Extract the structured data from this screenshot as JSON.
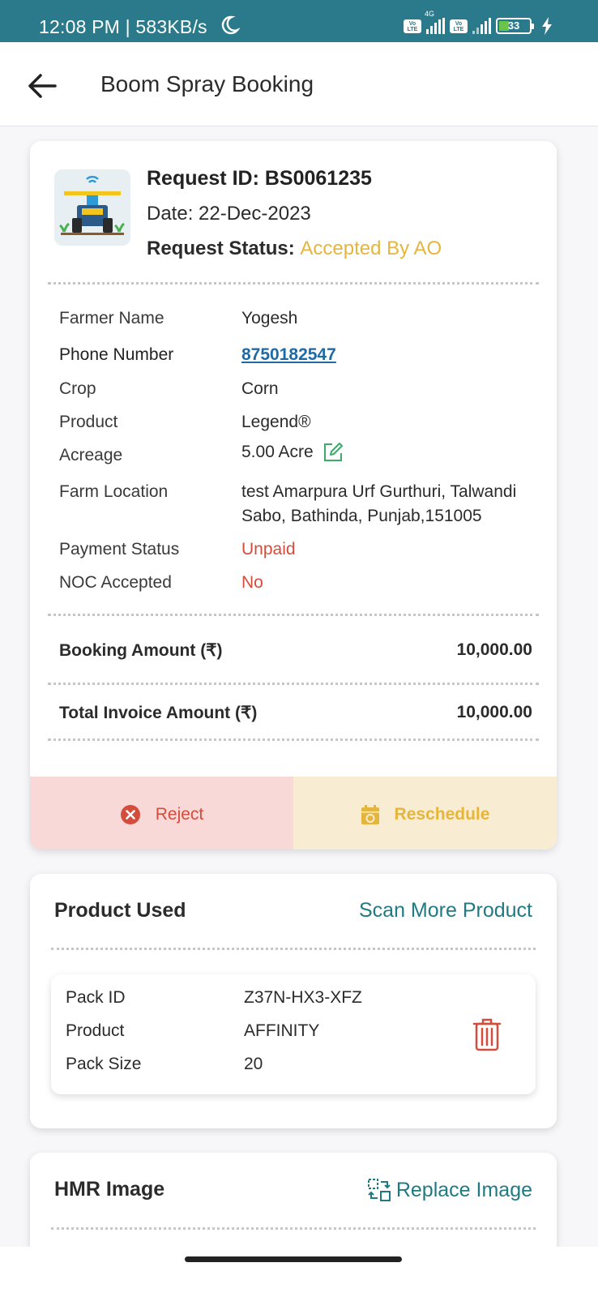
{
  "status_bar": {
    "time": "12:08 PM | 583KB/s",
    "network_type": "4G",
    "volte_label": "Vo LTE",
    "battery_level": "33",
    "icons": [
      "moon-icon",
      "signal-icon",
      "battery-icon",
      "charging-icon"
    ]
  },
  "app_bar": {
    "title": "Boom Spray Booking",
    "back_icon": "arrow-left-icon"
  },
  "request": {
    "id_label": "Request ID: BS0061235",
    "date_label": "Date: 22-Dec-2023",
    "status_label": "Request Status:",
    "status_value": "Accepted By AO",
    "status_color": "#e6b53b"
  },
  "details": [
    {
      "label": "Farmer Name",
      "value": "Yogesh"
    },
    {
      "label": "Phone Number",
      "value": "8750182547"
    },
    {
      "label": "Crop",
      "value": "Corn"
    },
    {
      "label": "Product",
      "value": "Legend®"
    },
    {
      "label": "Acreage",
      "value": "5.00 Acre"
    },
    {
      "label": "Farm Location",
      "value_line1": "test Amarpura Urf Gurthuri, Talwandi",
      "value_line2": "Sabo, Bathinda, Punjab,151005"
    },
    {
      "label": "Payment Status",
      "value": "Unpaid"
    },
    {
      "label": "NOC Accepted",
      "value": "No"
    }
  ],
  "amounts": {
    "booking_label": "Booking Amount (₹)",
    "booking_value": "10,000.00",
    "invoice_label": "Total Invoice Amount (₹)",
    "invoice_value": "10,000.00"
  },
  "actions": {
    "reject_label": "Reject",
    "reschedule_label": "Reschedule",
    "reject_color": "#d44c3b",
    "reschedule_color": "#e6b53b"
  },
  "product_used": {
    "title": "Product Used",
    "action_label": "Scan More Product",
    "pack": {
      "pack_id_label": "Pack ID",
      "pack_id_value": "Z37N-HX3-XFZ",
      "product_label": "Product",
      "product_value": "AFFINITY",
      "pack_size_label": "Pack Size",
      "pack_size_value": "20"
    }
  },
  "hmr": {
    "title": "HMR Image",
    "action_label": "Replace Image"
  },
  "colors": {
    "header_teal": "#2a7a8c",
    "link_blue": "#1f6aa5",
    "action_teal": "#1f7a82",
    "alert_red": "#d44c3b"
  }
}
